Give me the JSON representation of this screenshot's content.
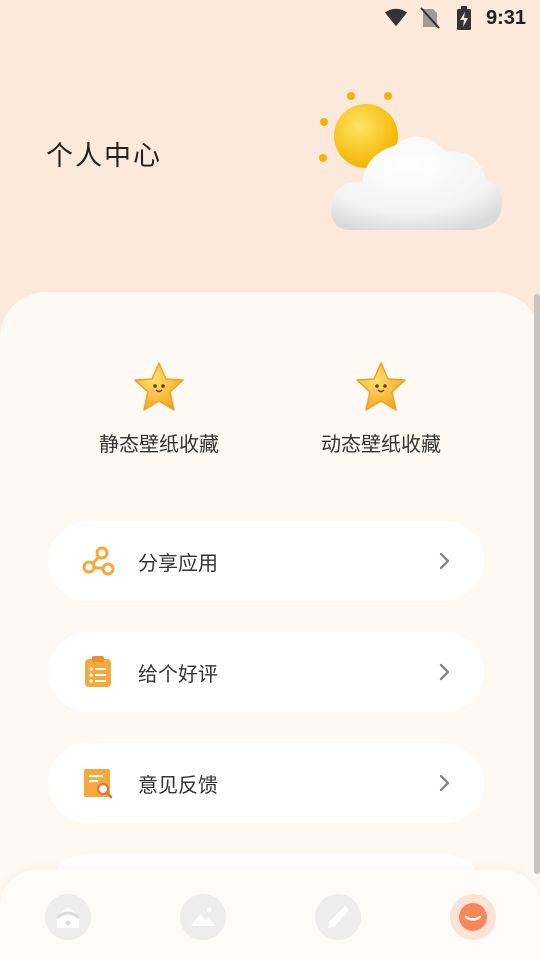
{
  "status_bar": {
    "time": "9:31",
    "icons": [
      "wifi-icon",
      "no-sim-icon",
      "battery-charging-icon"
    ]
  },
  "header": {
    "title": "个人中心",
    "illustration": "sun-behind-cloud-icon"
  },
  "favorites": [
    {
      "label": "静态壁纸收藏",
      "icon": "star-icon"
    },
    {
      "label": "动态壁纸收藏",
      "icon": "star-icon"
    }
  ],
  "menu": [
    {
      "label": "分享应用",
      "icon": "share-icon"
    },
    {
      "label": "给个好评",
      "icon": "clipboard-list-icon"
    },
    {
      "label": "意见反馈",
      "icon": "feedback-search-icon"
    }
  ],
  "tabs": [
    {
      "name": "home",
      "icon": "home-icon",
      "active": false
    },
    {
      "name": "wallpaper",
      "icon": "image-icon",
      "active": false
    },
    {
      "name": "edit",
      "icon": "pencil-icon",
      "active": false
    },
    {
      "name": "profile",
      "icon": "face-icon",
      "active": true
    }
  ],
  "colors": {
    "header_bg": "#fde8dc",
    "card_bg": "#fef9f2",
    "accent": "#f5a93a",
    "active_tab": "#f7875a"
  }
}
